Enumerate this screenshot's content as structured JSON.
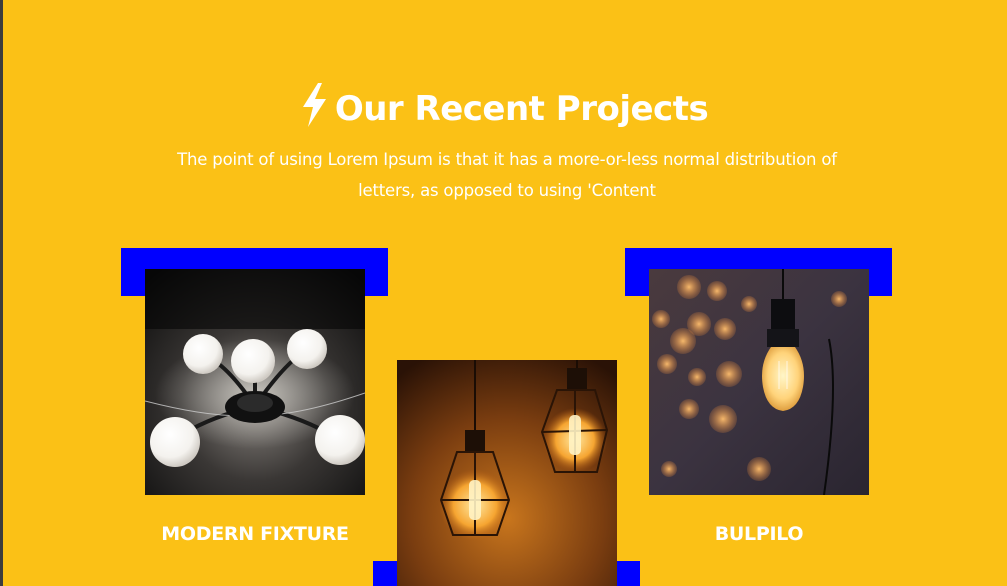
{
  "section": {
    "title": "Our Recent Projects",
    "title_icon": "lightning-bolt-icon",
    "description": "The point of using Lorem Ipsum is that it has a more-or-less normal distribution of letters, as opposed to using 'Content"
  },
  "projects": [
    {
      "name": "MODERN FIXTURE",
      "image": "ceiling-globe-light-fixture"
    },
    {
      "name": "",
      "image": "hanging-cage-bulbs"
    },
    {
      "name": "BULPILO",
      "image": "single-edison-bulb-bokeh"
    }
  ],
  "colors": {
    "background": "#fbc116",
    "accent_block": "#0000ff",
    "text": "#ffffff"
  }
}
